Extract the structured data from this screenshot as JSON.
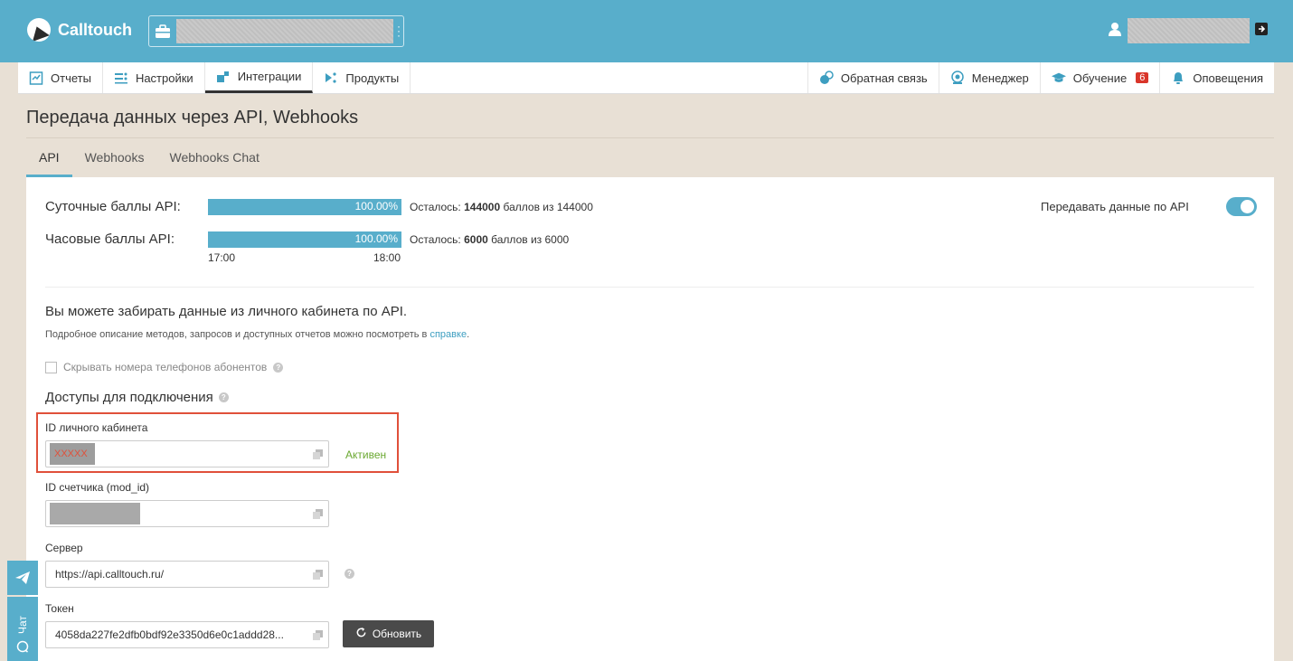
{
  "header": {
    "brand": "Calltouch",
    "colors": {
      "primary": "#58aecb",
      "danger": "#d9352a",
      "success": "#6aa830"
    }
  },
  "nav": {
    "left": [
      {
        "label": "Отчеты",
        "icon": "reports-icon"
      },
      {
        "label": "Настройки",
        "icon": "settings-icon"
      },
      {
        "label": "Интеграции",
        "icon": "integrations-icon",
        "active": true
      },
      {
        "label": "Продукты",
        "icon": "products-icon"
      }
    ],
    "right": [
      {
        "label": "Обратная связь",
        "icon": "feedback-icon"
      },
      {
        "label": "Менеджер",
        "icon": "manager-icon"
      },
      {
        "label": "Обучение",
        "icon": "education-icon",
        "badge": "6"
      },
      {
        "label": "Оповещения",
        "icon": "bell-icon"
      }
    ]
  },
  "page": {
    "title": "Передача данных через API, Webhooks",
    "tabs": [
      "API",
      "Webhooks",
      "Webhooks Chat"
    ],
    "active_tab": "API"
  },
  "scores": {
    "daily": {
      "label": "Суточные баллы API:",
      "percent_label": "100.00%",
      "percent": 100,
      "remain_prefix": "Осталось:",
      "remain_value": "144000",
      "remain_suffix": "баллов из 144000"
    },
    "hourly": {
      "label": "Часовые баллы API:",
      "percent_label": "100.00%",
      "percent": 100,
      "remain_prefix": "Осталось:",
      "remain_value": "6000",
      "remain_suffix": "баллов из 6000",
      "time_start": "17:00",
      "time_end": "18:00"
    }
  },
  "send_api": {
    "label": "Передавать данные по API",
    "enabled": true
  },
  "info": {
    "heading": "Вы можете забирать данные из личного кабинета по API.",
    "text_before": "Подробное описание методов, запросов и доступных отчетов можно посмотреть в",
    "link": "справке",
    "text_after": "."
  },
  "hide_phones": {
    "label": "Скрывать номера телефонов абонентов",
    "checked": false
  },
  "access": {
    "heading": "Доступы для подключения",
    "cabinet_id": {
      "label": "ID личного кабинета",
      "value": "XXXXX",
      "status": "Активен"
    },
    "counter_id": {
      "label": "ID счетчика (mod_id)"
    },
    "server": {
      "label": "Сервер",
      "value": "https://api.calltouch.ru/"
    },
    "token": {
      "label": "Токен",
      "value": "4058da227fe2dfb0bdf92e3350d6e0c1addd28...",
      "refresh_label": "Обновить"
    }
  },
  "widgets": {
    "chat_label": "Чат"
  }
}
